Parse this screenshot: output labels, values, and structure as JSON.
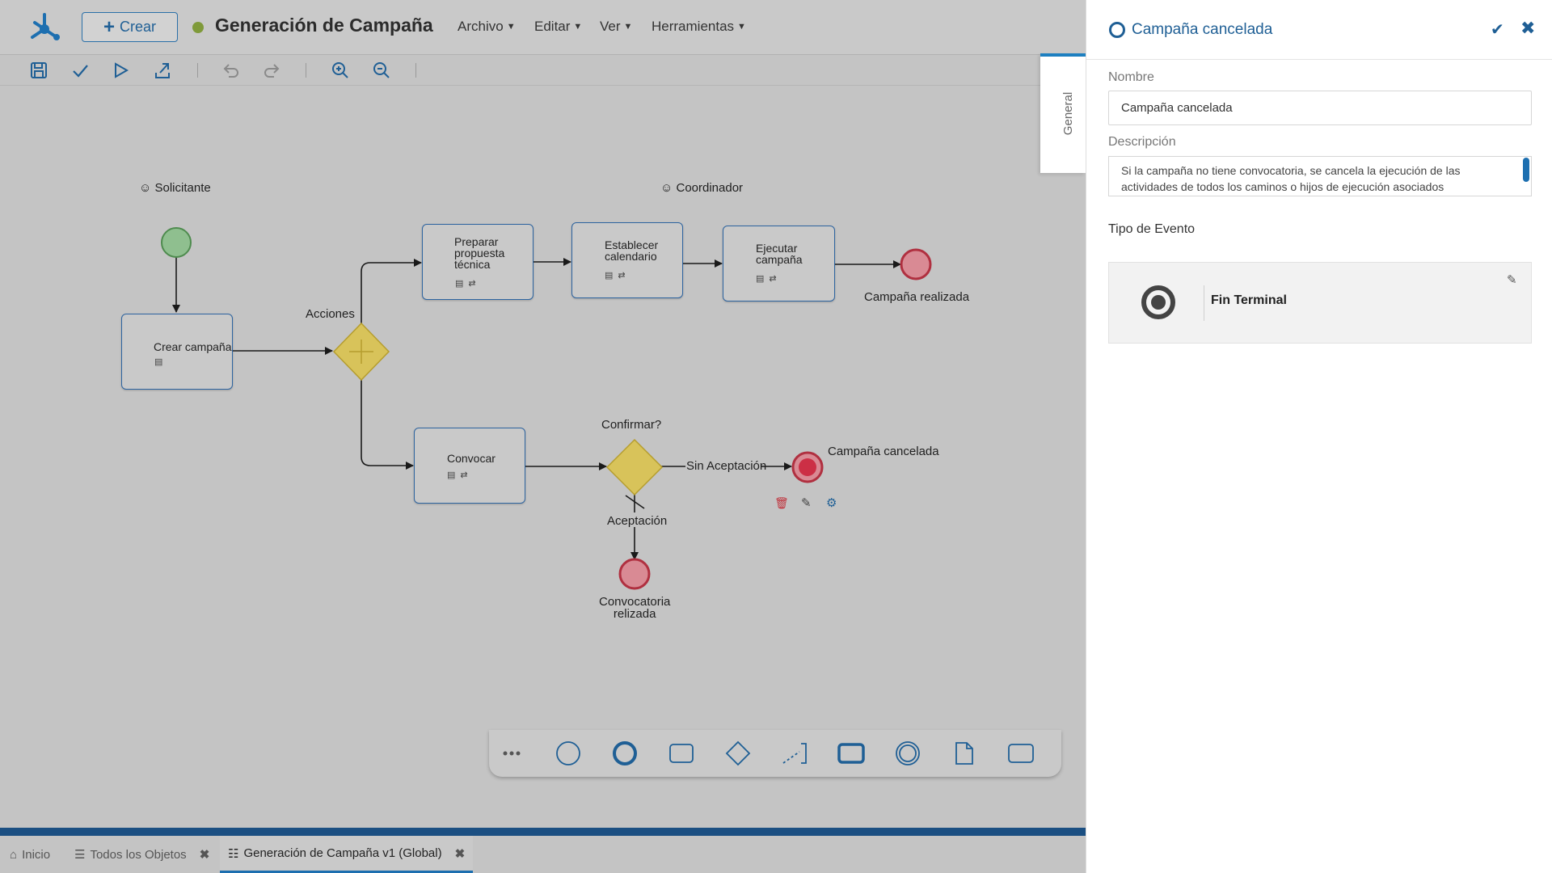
{
  "header": {
    "crear_label": "Crear",
    "title": "Generación de Campaña",
    "status_color": "#7f9a3a",
    "menus": [
      "Archivo",
      "Editar",
      "Ver",
      "Herramientas"
    ]
  },
  "toolbar": {
    "tools": [
      "save-icon",
      "check-icon",
      "play-icon",
      "export-icon",
      "undo-icon",
      "redo-icon",
      "zoom-in-icon",
      "zoom-out-icon"
    ]
  },
  "diagram": {
    "lanes": [
      "Solicitante",
      "Coordinador"
    ],
    "tasks": {
      "crear": "Crear campaña",
      "preparar": [
        "Preparar",
        "propuesta",
        "técnica"
      ],
      "establecer": [
        "Establecer",
        "calendario"
      ],
      "ejecutar": [
        "Ejecutar",
        "campaña"
      ],
      "convocar": "Convocar"
    },
    "gateways": {
      "acciones": "Acciones",
      "confirmar": "Confirmar?"
    },
    "flows": {
      "sin_aceptacion": "Sin Aceptación",
      "aceptacion": "Aceptación"
    },
    "end_events": {
      "realizada": "Campaña realizada",
      "cancelada": "Campaña cancelada",
      "convocatoria": [
        "Convocatoria",
        "relizada"
      ]
    }
  },
  "palette": {
    "items": [
      "more-icon",
      "start-event-icon",
      "end-event-icon",
      "task-icon",
      "gateway-icon",
      "annotation-icon",
      "subprocess-icon",
      "intermediate-event-icon",
      "data-object-icon",
      "pool-icon"
    ]
  },
  "bottom_tabs": [
    {
      "label": "Inicio"
    },
    {
      "label": "Todos los Objetos"
    },
    {
      "label": "Generación de Campaña v1 (Global)"
    }
  ],
  "panel": {
    "title": "Campaña cancelada",
    "side_tab": "General",
    "nombre_label": "Nombre",
    "nombre_value": "Campaña cancelada",
    "descripcion_label": "Descripción",
    "descripcion_value": "Si la campaña no tiene convocatoria, se cancela la ejecución de las actividades de todos los caminos o hijos de ejecución asociados",
    "tipo_label": "Tipo de Evento",
    "event_type": "Fin Terminal"
  },
  "colors": {
    "accent": "#1f5f95",
    "start_event": "#8fbf8f",
    "end_event": "#d98a94",
    "gateway": "#d8c35a",
    "task_border": "#2d64a0"
  }
}
